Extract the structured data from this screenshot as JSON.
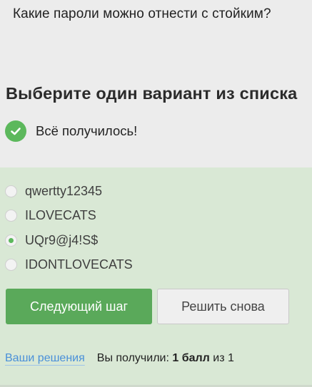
{
  "question": {
    "text": "Какие пароли можно отнести с стойким?"
  },
  "section": {
    "title": "Выберите один вариант из списка"
  },
  "feedback": {
    "icon": "check-icon",
    "text": "Всё получилось!",
    "color": "#5cb85c"
  },
  "options": [
    {
      "label": "qwertty12345",
      "selected": false
    },
    {
      "label": "ILOVECATS",
      "selected": false
    },
    {
      "label": "UQr9@j4!S$",
      "selected": true
    },
    {
      "label": "IDONTLOVECATS",
      "selected": false
    }
  ],
  "buttons": {
    "next_label": "Следующий шаг",
    "retry_label": "Решить снова"
  },
  "footer": {
    "solutions_link": "Ваши решения",
    "score_prefix": "Вы получили:",
    "score_value": "1 балл",
    "score_suffix": "из 1"
  },
  "colors": {
    "accent": "#5cb85c",
    "panel_bg": "#d9e8d5",
    "page_bg": "#ececec",
    "link": "#4a90d9"
  }
}
